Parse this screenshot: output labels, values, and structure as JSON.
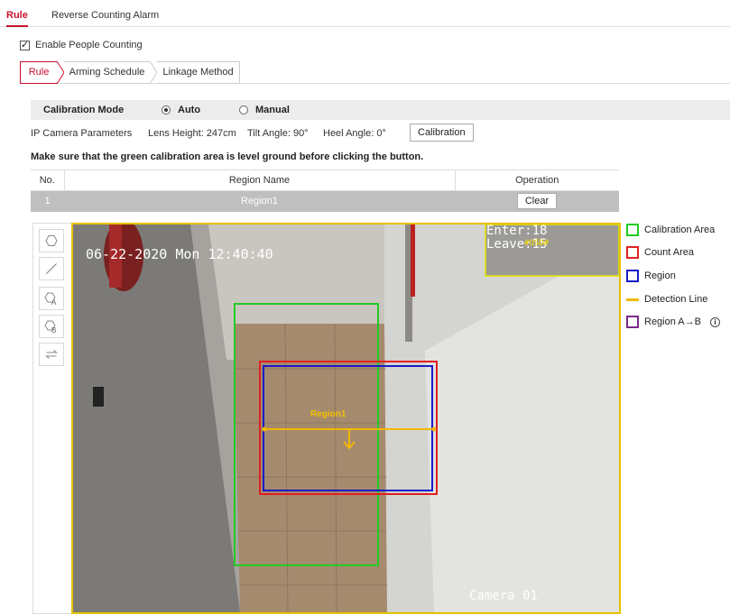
{
  "top_tabs": [
    {
      "label": "Rule",
      "active": true
    },
    {
      "label": "Reverse Counting Alarm",
      "active": false
    }
  ],
  "enable": {
    "label": "Enable People Counting",
    "checked": true
  },
  "steps": [
    {
      "label": "Rule",
      "active": true
    },
    {
      "label": "Arming Schedule",
      "active": false
    },
    {
      "label": "Linkage Method",
      "active": false
    }
  ],
  "calibration": {
    "mode_label": "Calibration Mode",
    "options": [
      "Auto",
      "Manual"
    ],
    "selected": "Auto",
    "params_label": "IP Camera Parameters",
    "lens_height": "Lens Height:  247cm",
    "tilt_angle": "Tilt Angle:  90°",
    "heel_angle": "Heel Angle: 0°",
    "button": "Calibration",
    "warning": "Make sure that the green calibration area is level ground before clicking the button."
  },
  "region_table": {
    "headers": [
      "No.",
      "Region Name",
      "Operation"
    ],
    "rows": [
      {
        "no": "1",
        "name": "Region1",
        "op": "Clear"
      }
    ]
  },
  "toolbar": [
    "hexagon-icon",
    "line-icon",
    "region-a-icon",
    "region-b-icon",
    "swap-icon"
  ],
  "video": {
    "timestamp": "06-22-2020 Mon 12:40:40",
    "enter": "Enter:18",
    "leave": "Leave:15",
    "osd_tag": "#OSD#",
    "camera": "Camera 01",
    "region_label": "Region1"
  },
  "legend": {
    "items": [
      {
        "label": "Calibration Area",
        "color": "#22cc22"
      },
      {
        "label": "Count Area",
        "color": "#e02020"
      },
      {
        "label": "Region",
        "color": "#1a1acc"
      },
      {
        "label": "Detection Line",
        "color": "#f2b800"
      },
      {
        "label": "Region A→B",
        "color": "#7a2a8a"
      }
    ]
  }
}
